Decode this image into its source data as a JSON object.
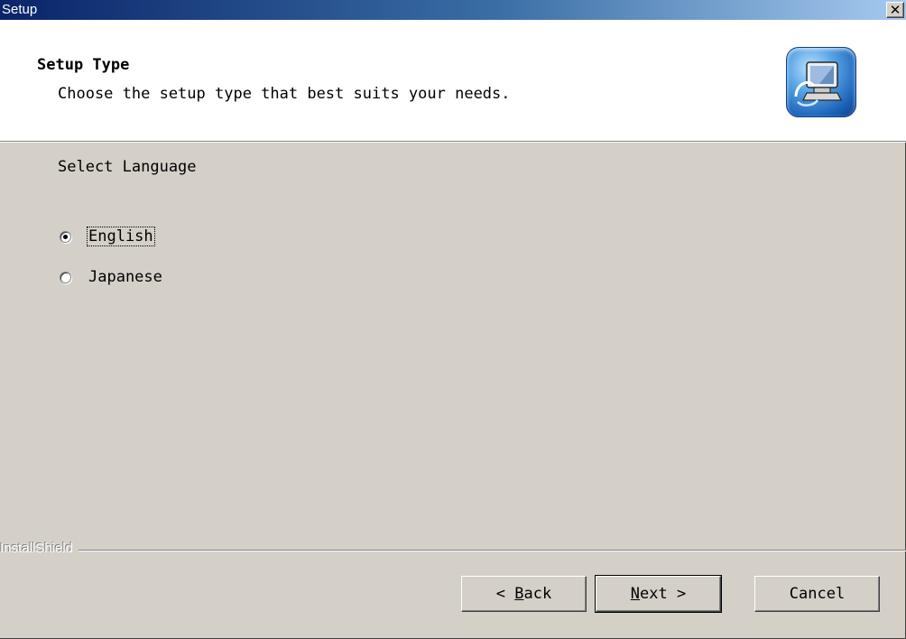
{
  "window": {
    "title": "Setup"
  },
  "header": {
    "title": "Setup Type",
    "subtitle": "Choose the setup type that best suits your needs.",
    "logo_icon": "installshield-computer-icon"
  },
  "body": {
    "section_label": "Select Language",
    "options": [
      {
        "label": "English",
        "selected": true
      },
      {
        "label": "Japanese",
        "selected": false
      }
    ]
  },
  "footer": {
    "brand": "InstallShield",
    "buttons": {
      "back": {
        "prefix": "< ",
        "mnemonic": "B",
        "rest": "ack"
      },
      "next": {
        "mnemonic": "N",
        "rest": "ext >"
      },
      "cancel": "Cancel"
    }
  },
  "colors": {
    "face": "#d4d0c8",
    "title_start": "#0a246a",
    "title_end": "#a6caf0"
  }
}
